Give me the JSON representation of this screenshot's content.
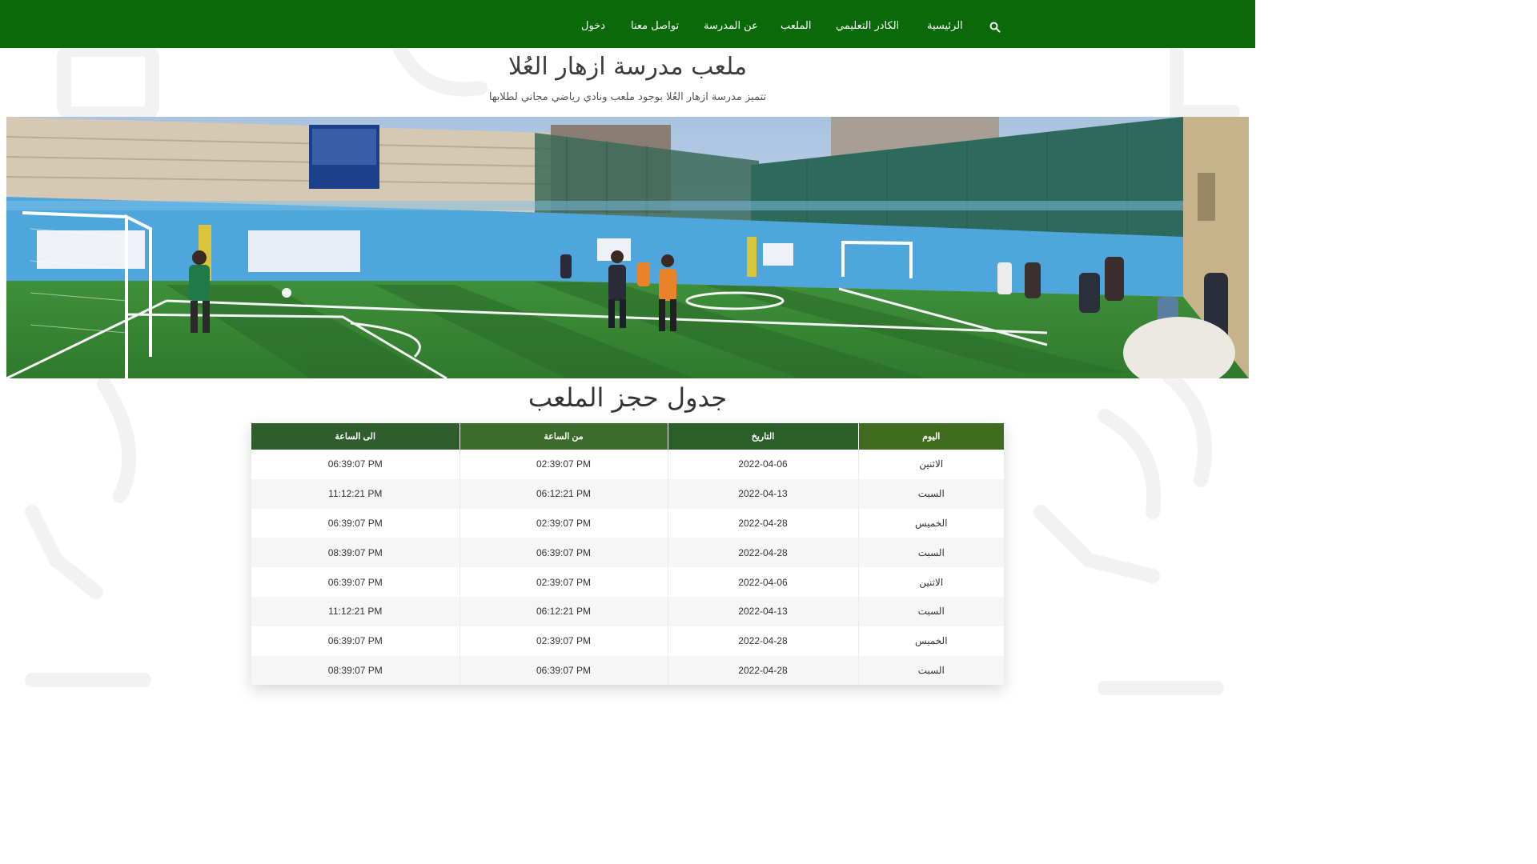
{
  "nav": {
    "items": [
      {
        "label": "الرئيسية"
      },
      {
        "label": "الكادر التعليمي"
      },
      {
        "label": "الملعب"
      },
      {
        "label": "عن المدرسة"
      },
      {
        "label": "تواصل معنا"
      },
      {
        "label": "دخول"
      }
    ]
  },
  "page": {
    "title": "ملعب مدرسة ازهار العُلا",
    "subtitle": "تتميز مدرسة ازهار العُلا بوجود ملعب ونادي رياضي مجاني لطلابها"
  },
  "schedule": {
    "title": "جدول حجز الملعب",
    "columns": {
      "day": "اليوم",
      "date": "التاريخ",
      "from": "من الساعة",
      "to": "الى الساعة"
    },
    "rows": [
      {
        "to": "06:39:07 PM",
        "from": "02:39:07 PM",
        "date": "2022-04-06",
        "day": "الاثنين"
      },
      {
        "to": "11:12:21 PM",
        "from": "06:12:21 PM",
        "date": "2022-04-13",
        "day": "السبت"
      },
      {
        "to": "06:39:07 PM",
        "from": "02:39:07 PM",
        "date": "2022-04-28",
        "day": "الخميس"
      },
      {
        "to": "08:39:07 PM",
        "from": "06:39:07 PM",
        "date": "2022-04-28",
        "day": "السبت"
      },
      {
        "to": "06:39:07 PM",
        "from": "02:39:07 PM",
        "date": "2022-04-06",
        "day": "الاثنين"
      },
      {
        "to": "11:12:21 PM",
        "from": "06:12:21 PM",
        "date": "2022-04-13",
        "day": "السبت"
      },
      {
        "to": "06:39:07 PM",
        "from": "02:39:07 PM",
        "date": "2022-04-28",
        "day": "الخميس"
      },
      {
        "to": "08:39:07 PM",
        "from": "06:39:07 PM",
        "date": "2022-04-28",
        "day": "السبت"
      }
    ]
  },
  "icons": {
    "search": "search-icon"
  },
  "colors": {
    "navbar": "#0a6a0a",
    "header_day": "#3f6c1f",
    "header_date": "#2c5e2a",
    "header_from": "#3c6b2b",
    "header_to": "#2f5d2c"
  }
}
